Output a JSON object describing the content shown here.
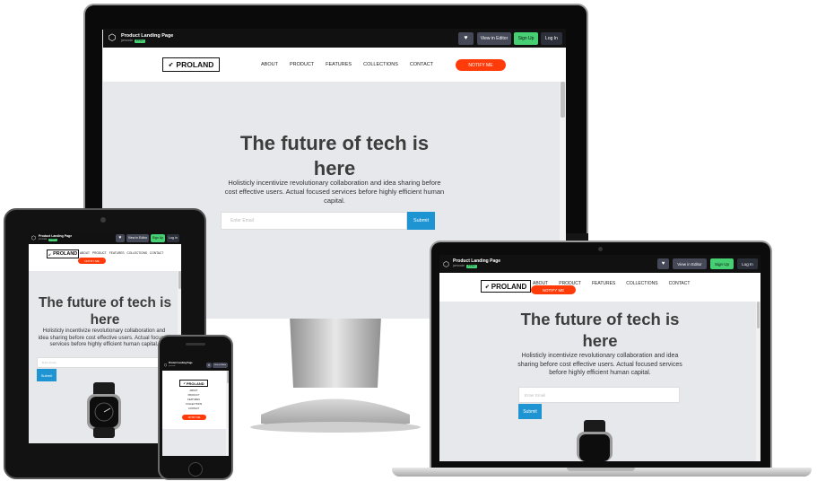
{
  "codepen": {
    "title": "Product Landing Page",
    "author": "jcmcode",
    "badge": "PRO",
    "view_editor": "View in Editor",
    "signup": "Sign Up",
    "login": "Log In",
    "heart": "♥"
  },
  "site": {
    "brand": "PROLAND",
    "nav": [
      "ABOUT",
      "PRODUCT",
      "FEATURES",
      "COLLECTIONS",
      "CONTACT"
    ],
    "cta": "NOTIFY ME",
    "hero_title": "The future of tech is here",
    "hero_desc": "Holisticly incentivize revolutionary collaboration and idea sharing before cost effective users. Actual focused services before highly efficient human capital.",
    "email_placeholder": "Enter Email",
    "submit": "Submit"
  },
  "colors": {
    "accent": "#ff3b0a",
    "submit": "#1e94d2",
    "signup": "#47cf73",
    "hero_bg": "#e6e8ec"
  }
}
